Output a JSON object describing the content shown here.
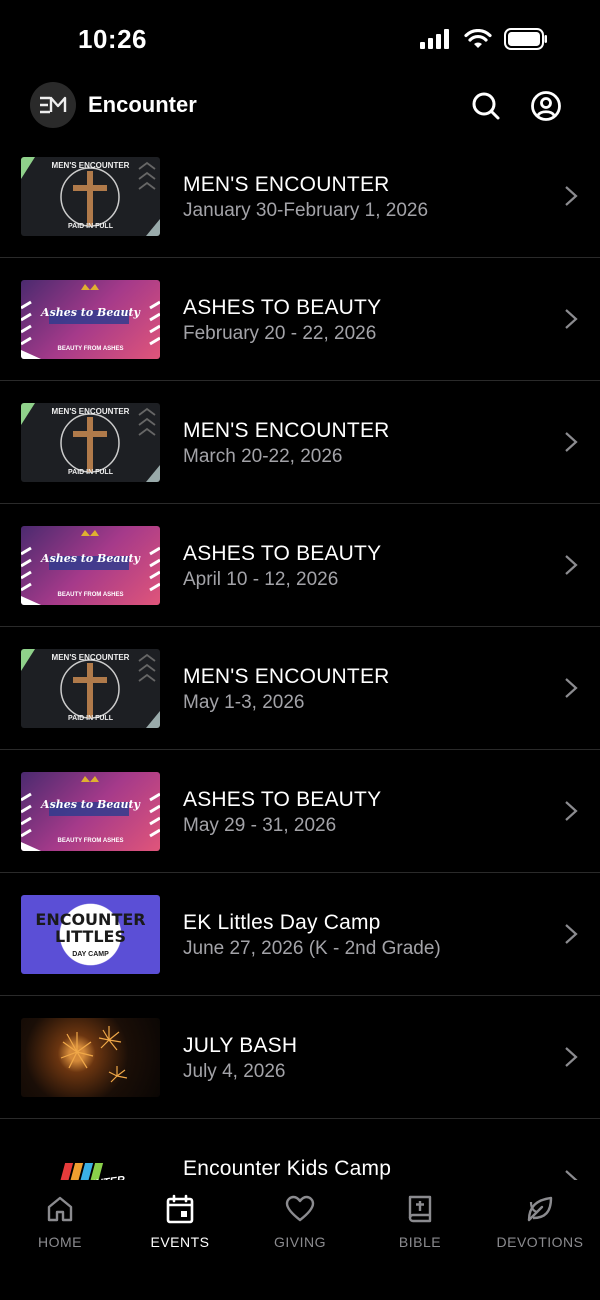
{
  "status_bar": {
    "time": "10:26"
  },
  "header": {
    "title": "Encounter"
  },
  "events": [
    {
      "title": "MEN'S ENCOUNTER",
      "date": "January 30-February 1, 2026",
      "thumb": "mens"
    },
    {
      "title": "ASHES TO BEAUTY",
      "date": "February 20 - 22, 2026",
      "thumb": "ashes"
    },
    {
      "title": "MEN'S ENCOUNTER",
      "date": "March 20-22, 2026",
      "thumb": "mens"
    },
    {
      "title": "ASHES TO BEAUTY",
      "date": "April 10 - 12, 2026",
      "thumb": "ashes"
    },
    {
      "title": "MEN'S ENCOUNTER",
      "date": "May 1-3, 2026",
      "thumb": "mens"
    },
    {
      "title": "ASHES TO BEAUTY",
      "date": "May 29 - 31, 2026",
      "thumb": "ashes"
    },
    {
      "title": "EK Littles Day Camp",
      "date": "June 27, 2026 (K - 2nd Grade)",
      "thumb": "littles"
    },
    {
      "title": "JULY BASH",
      "date": "July 4, 2026",
      "thumb": "bash"
    },
    {
      "title": "Encounter Kids Camp",
      "date": "",
      "thumb": "kids"
    }
  ],
  "thumb_text": {
    "mens_top": "MEN'S ENCOUNTER",
    "mens_bottom": "PAID IN FULL",
    "ashes_main": "Ashes to Beauty",
    "ashes_sub": "BEAUTY FROM ASHES",
    "littles_main": "ENCOUNTER LITTLES",
    "littles_sub": "DAY CAMP",
    "kids_main": "ENCOUNTER"
  },
  "tabs": [
    {
      "label": "HOME",
      "icon": "home-icon",
      "active": false
    },
    {
      "label": "EVENTS",
      "icon": "calendar-icon",
      "active": true
    },
    {
      "label": "GIVING",
      "icon": "heart-icon",
      "active": false
    },
    {
      "label": "BIBLE",
      "icon": "bible-icon",
      "active": false
    },
    {
      "label": "DEVOTIONS",
      "icon": "leaf-icon",
      "active": false
    }
  ],
  "colors": {
    "background": "#000000",
    "text_primary": "#ffffff",
    "text_secondary": "#a3a3a8",
    "tab_inactive": "#8b8b8f",
    "divider": "#2a2a2a"
  }
}
